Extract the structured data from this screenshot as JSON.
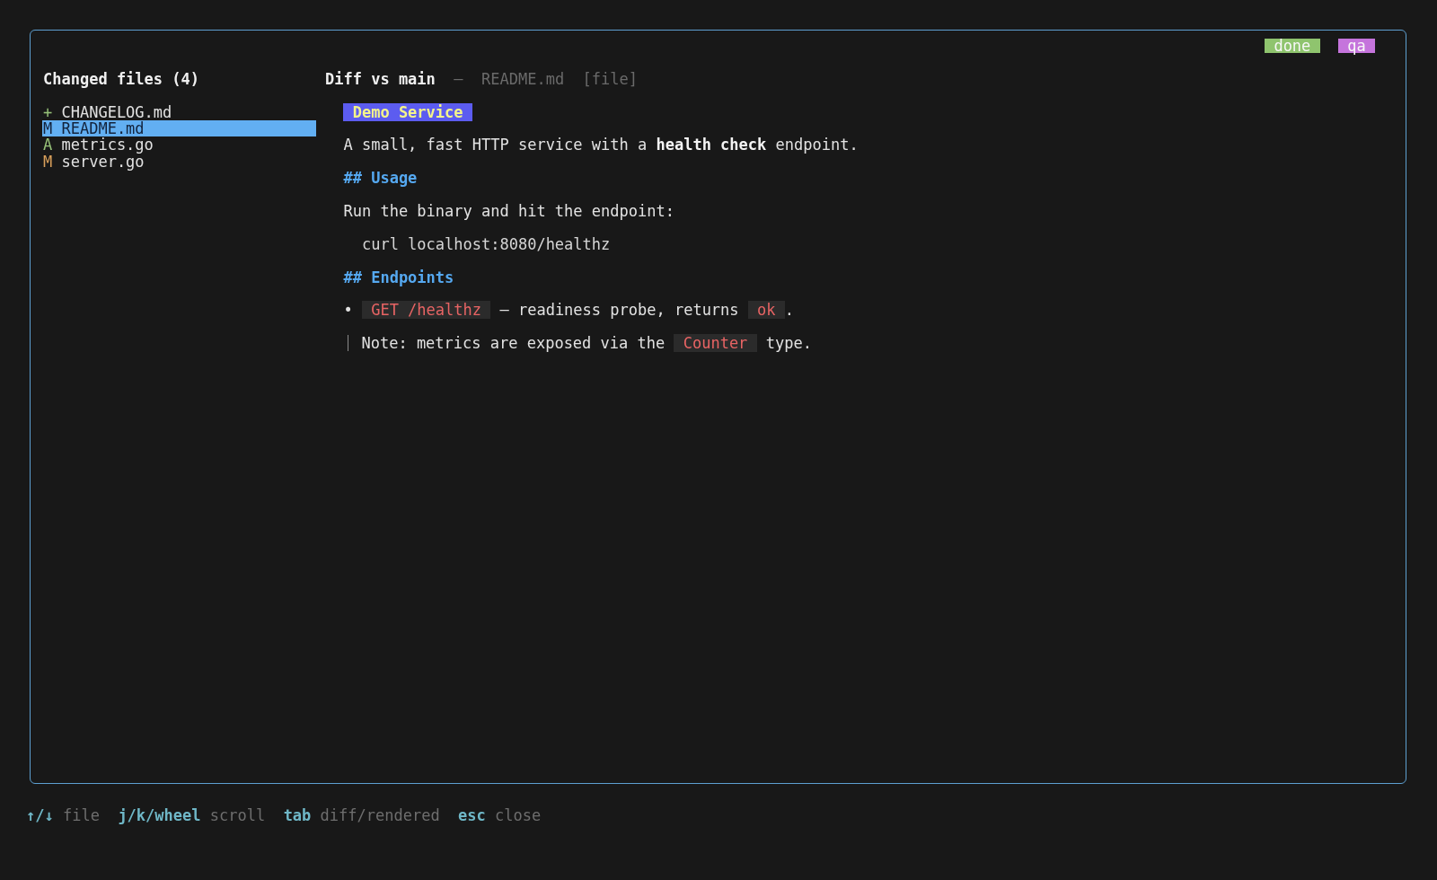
{
  "status_tags": [
    {
      "label": "done",
      "color": "#8fc46e"
    },
    {
      "label": "qa",
      "color": "#c574dc"
    }
  ],
  "changed_files": {
    "title": "Changed files (4)",
    "items": [
      {
        "status": "+",
        "kind": "new",
        "name": "CHANGELOG.md",
        "selected": false
      },
      {
        "status": "M",
        "kind": "modified",
        "name": "README.md",
        "selected": true
      },
      {
        "status": "A",
        "kind": "added",
        "name": "metrics.go",
        "selected": false
      },
      {
        "status": "M",
        "kind": "modified",
        "name": "server.go",
        "selected": false
      }
    ]
  },
  "diff_view": {
    "title": "Diff vs main",
    "separator": "—",
    "file": "README.md",
    "mode": "[file]",
    "blocks": [
      {
        "kind": "banner",
        "text": "Demo Service"
      },
      {
        "kind": "paragraph",
        "text": "A small, fast HTTP service with a **health check** endpoint."
      },
      {
        "kind": "heading",
        "text": "## Usage"
      },
      {
        "kind": "paragraph",
        "text": "Run the binary and hit the endpoint:"
      },
      {
        "kind": "code",
        "text": "curl localhost:8080/healthz"
      },
      {
        "kind": "heading",
        "text": "## Endpoints"
      },
      {
        "kind": "bullet",
        "bullet": "•",
        "parts": [
          {
            "kind": "code",
            "text": "GET /healthz"
          },
          {
            "kind": "text",
            "text": " — readiness probe, returns "
          },
          {
            "kind": "code",
            "text": "ok"
          },
          {
            "kind": "text",
            "text": "."
          }
        ]
      },
      {
        "kind": "quote",
        "parts": [
          {
            "kind": "text",
            "text": "Note: metrics are exposed via the "
          },
          {
            "kind": "code",
            "text": "Counter"
          },
          {
            "kind": "text",
            "text": " type."
          }
        ]
      }
    ]
  },
  "help_bar": [
    {
      "key": "↑/↓",
      "action": "file"
    },
    {
      "key": "j/k/wheel",
      "action": "scroll"
    },
    {
      "key": "tab",
      "action": "diff/rendered"
    },
    {
      "key": "esc",
      "action": "close"
    }
  ]
}
